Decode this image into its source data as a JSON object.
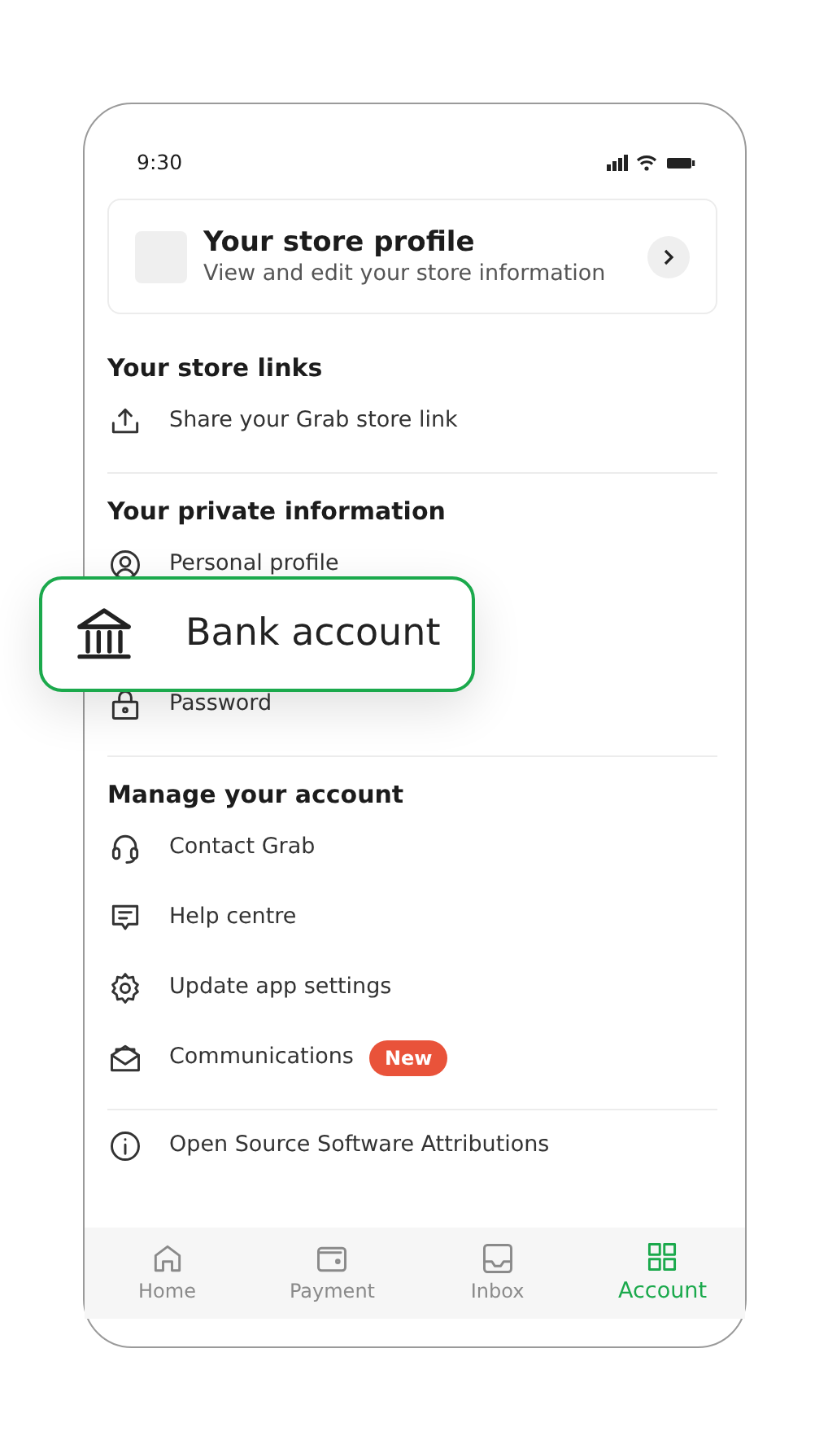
{
  "status_bar": {
    "time": "9:30"
  },
  "store_profile": {
    "title": "Your store profile",
    "subtitle": "View and edit your store information"
  },
  "sections": [
    {
      "title": "Your store links",
      "items": [
        {
          "kind": "share",
          "label": "Share your Grab store link"
        }
      ]
    },
    {
      "title": "Your private information",
      "items": [
        {
          "kind": "person",
          "label": "Personal profile"
        },
        {
          "kind": "bank",
          "label": "Bank account",
          "highlighted": true
        },
        {
          "kind": "lock",
          "label": "Password"
        }
      ]
    },
    {
      "title": "Manage your account",
      "items": [
        {
          "kind": "headset",
          "label": "Contact Grab"
        },
        {
          "kind": "chat",
          "label": "Help centre"
        },
        {
          "kind": "gear",
          "label": "Update app settings"
        },
        {
          "kind": "envelope",
          "label": "Communications",
          "badge": "New"
        }
      ]
    },
    {
      "items": [
        {
          "kind": "info",
          "label": "Open Source Software Attributions"
        }
      ]
    }
  ],
  "tabs": [
    {
      "kind": "home",
      "label": "Home",
      "selected": false
    },
    {
      "kind": "wallet",
      "label": "Payment",
      "selected": false
    },
    {
      "kind": "inbox",
      "label": "Inbox",
      "selected": false
    },
    {
      "kind": "grid",
      "label": "Account",
      "selected": true
    }
  ]
}
